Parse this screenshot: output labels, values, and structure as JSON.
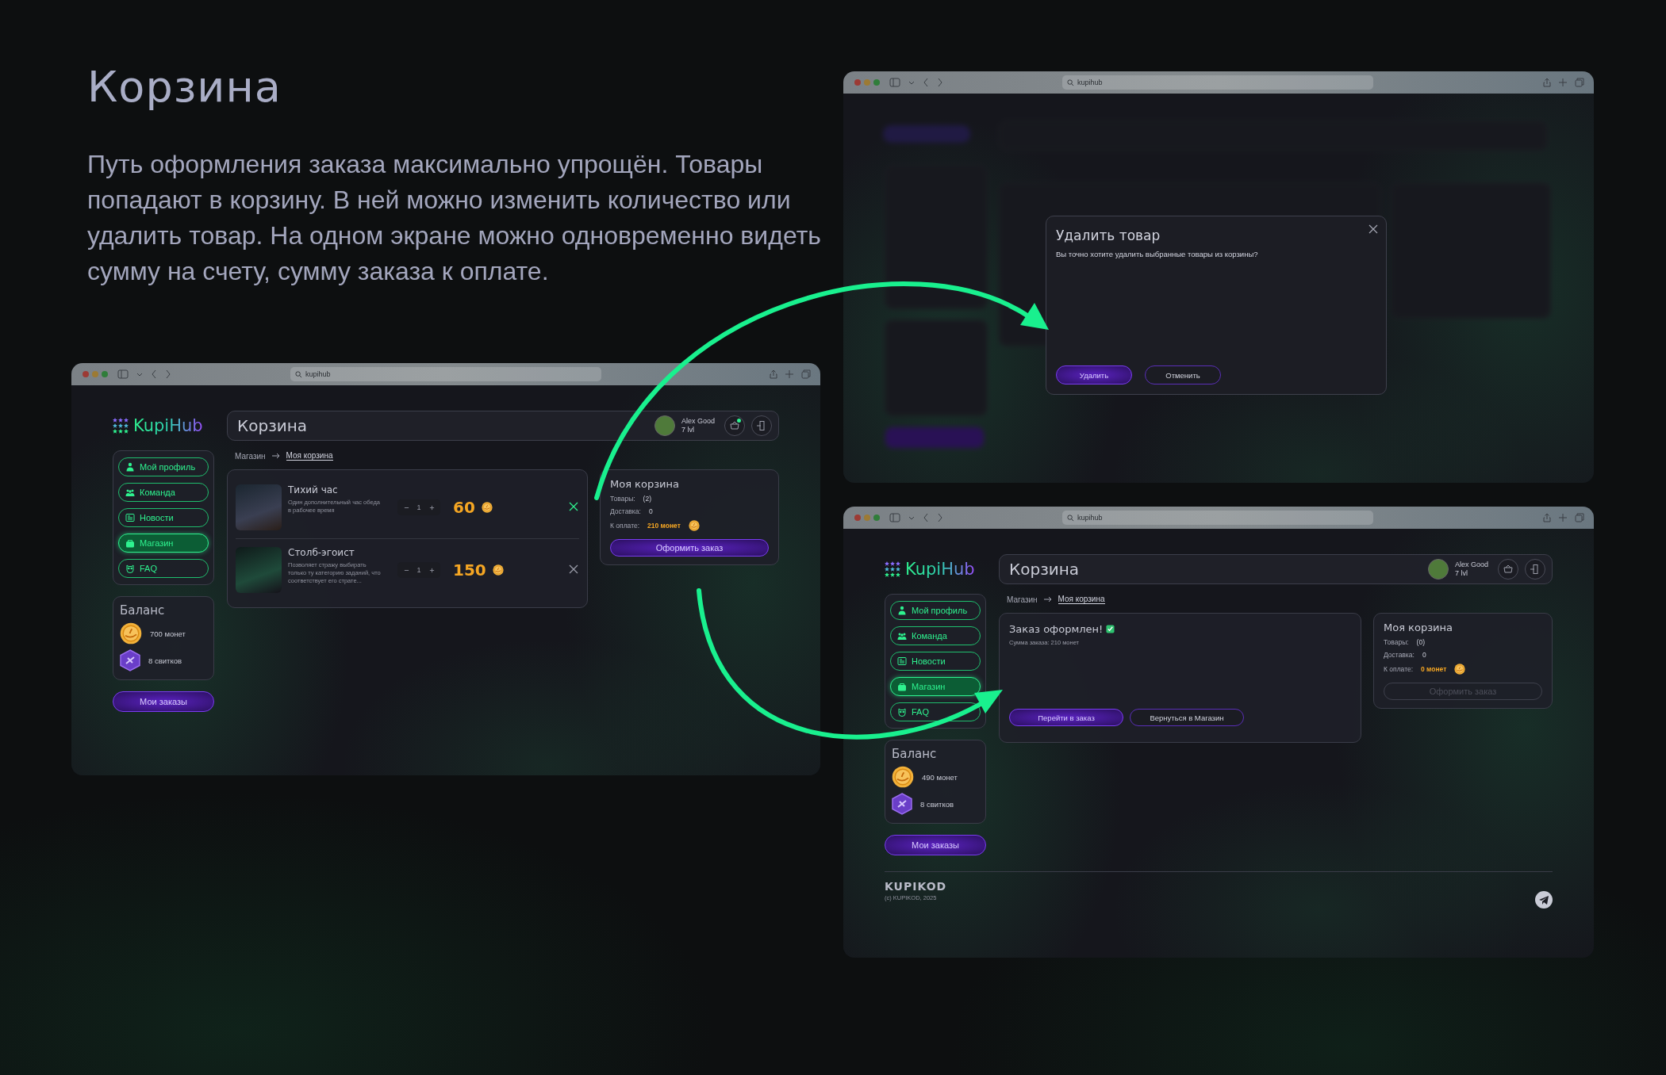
{
  "heading": "Корзина",
  "description": "Путь оформления заказа максимально упрощён. Товары попадают в корзину. В ней можно изменить количество или удалить товар. На одном экране можно одновременно видеть сумму на счету, сумму заказа к оплате.",
  "windows": [
    {
      "kind": "cart",
      "address": "kupihub",
      "logo": "KupiHub",
      "page_title": "Корзина",
      "user": {
        "name": "Alex Good",
        "level": "7 lvl"
      },
      "cart_notification": true,
      "nav": [
        {
          "label": "Мой профиль",
          "selected": false
        },
        {
          "label": "Команда",
          "selected": false
        },
        {
          "label": "Новости",
          "selected": false
        },
        {
          "label": "Магазин",
          "selected": true
        },
        {
          "label": "FAQ",
          "selected": false
        }
      ],
      "breadcrumb": [
        "Магазин",
        "Моя корзина"
      ],
      "items": [
        {
          "title": "Тихий час",
          "description": "Один дополнительный час обеда в рабочее время",
          "quantity": "1",
          "price": "60",
          "highlighted": true
        },
        {
          "title": "Столб-эгоист",
          "description": "Позволяет стражу выбирать только ту категорию заданий, что соответствует его страте...",
          "quantity": "1",
          "price": "150",
          "highlighted": false
        }
      ],
      "summary": {
        "title": "Моя корзина",
        "rows": [
          {
            "label": "Товары:",
            "value": "(2)",
            "kind": "plain"
          },
          {
            "label": "Доставка:",
            "value": "0",
            "kind": "plain"
          },
          {
            "label": "К оплате:",
            "value": "210 монет",
            "kind": "price"
          }
        ],
        "button": {
          "label": "Оформить заказ",
          "disabled": false
        }
      },
      "balance": {
        "title": "Баланс",
        "coins": "700 монет",
        "scrolls": "8 свитков"
      },
      "orders_button": "Мои заказы"
    },
    {
      "kind": "dialog",
      "address": "kupihub",
      "dialog": {
        "title": "Удалить товар",
        "message": "Вы точно хотите удалить выбранные товары из корзины?",
        "buttons": [
          {
            "label": "Удалить",
            "kind": "primary"
          },
          {
            "label": "Отменить",
            "kind": "secondary"
          }
        ]
      }
    },
    {
      "kind": "done",
      "address": "kupihub",
      "logo": "KupiHub",
      "page_title": "Корзина",
      "user": {
        "name": "Alex Good",
        "level": "7 lvl"
      },
      "cart_notification": false,
      "nav": [
        {
          "label": "Мой профиль",
          "selected": false
        },
        {
          "label": "Команда",
          "selected": false
        },
        {
          "label": "Новости",
          "selected": false
        },
        {
          "label": "Магазин",
          "selected": true
        },
        {
          "label": "FAQ",
          "selected": false
        }
      ],
      "breadcrumb": [
        "Магазин",
        "Моя корзина"
      ],
      "order": {
        "title": "Заказ оформлен!",
        "subtitle": "Сумма заказа: 210 монет",
        "buttons": [
          {
            "label": "Перейти в заказ",
            "kind": "primary"
          },
          {
            "label": "Вернуться в Магазин",
            "kind": "secondary"
          }
        ]
      },
      "summary": {
        "title": "Моя корзина",
        "rows": [
          {
            "label": "Товары:",
            "value": "(0)",
            "kind": "plain"
          },
          {
            "label": "Доставка:",
            "value": "0",
            "kind": "plain"
          },
          {
            "label": "К оплате:",
            "value": "0 монет",
            "kind": "price"
          }
        ],
        "button": {
          "label": "Оформить заказ",
          "disabled": true
        }
      },
      "balance": {
        "title": "Баланс",
        "coins": "490 монет",
        "scrolls": "8 свитков"
      },
      "orders_button": "Мои заказы",
      "footer": {
        "logo": "KUPIKOD",
        "copyright": "(c) KUPIKOD, 2025"
      }
    }
  ]
}
